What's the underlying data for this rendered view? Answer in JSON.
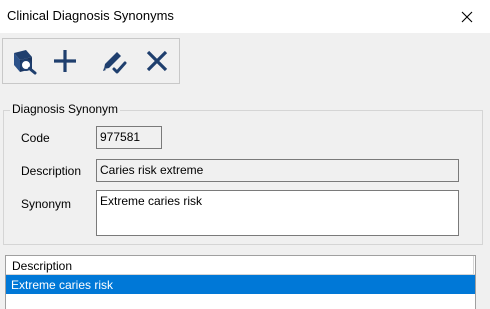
{
  "window": {
    "title": "Clinical Diagnosis Synonyms"
  },
  "toolbar": {
    "buttons": [
      {
        "icon": "search-list-icon",
        "color": "#1f3f6e"
      },
      {
        "icon": "add-icon",
        "color": "#1f3f6e"
      },
      {
        "icon": "edit-icon",
        "color": "#1f3f6e"
      },
      {
        "icon": "delete-icon",
        "color": "#1f3f6e"
      }
    ]
  },
  "group": {
    "legend": "Diagnosis Synonym",
    "code_label": "Code",
    "code_value": "977581",
    "description_label": "Description",
    "description_value": "Caries risk extreme",
    "synonym_label": "Synonym",
    "synonym_value": "Extreme caries risk"
  },
  "grid": {
    "columns": [
      "Description"
    ],
    "rows": [
      {
        "description": "Extreme caries risk",
        "selected": true
      }
    ],
    "selection_color": "#0078d7"
  }
}
